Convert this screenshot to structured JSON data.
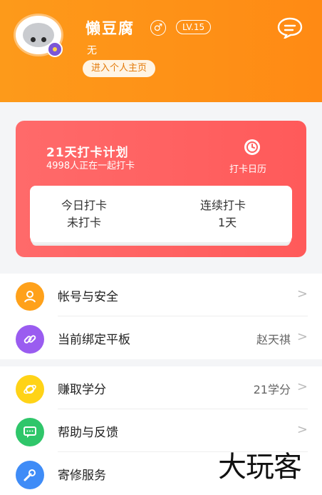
{
  "profile": {
    "name": "懒豆腐",
    "gender_symbol": "♂",
    "level": "LV.15",
    "signature": "无",
    "home_button": "进入个人主页"
  },
  "checkin": {
    "title": "21天打卡计划",
    "subtitle": "4998人正在一起打卡",
    "calendar_label": "打卡日历",
    "today_title": "今日打卡",
    "today_value": "未打卡",
    "streak_title": "连续打卡",
    "streak_value": "1天"
  },
  "menu": [
    {
      "label": "帐号与安全",
      "value": "",
      "icon": "user-icon",
      "color": "#ffa11a"
    },
    {
      "label": "当前绑定平板",
      "value": "赵天祺",
      "icon": "link-icon",
      "color": "#9a5cf0"
    },
    {
      "label": "赚取学分",
      "value": "21学分",
      "icon": "planet-icon",
      "color": "#ffd317"
    },
    {
      "label": "帮助与反馈",
      "value": "",
      "icon": "message-icon",
      "color": "#2fc66a"
    },
    {
      "label": "寄修服务",
      "value": "",
      "icon": "wrench-icon",
      "color": "#3f8cf7"
    }
  ],
  "watermark": "大玩客"
}
